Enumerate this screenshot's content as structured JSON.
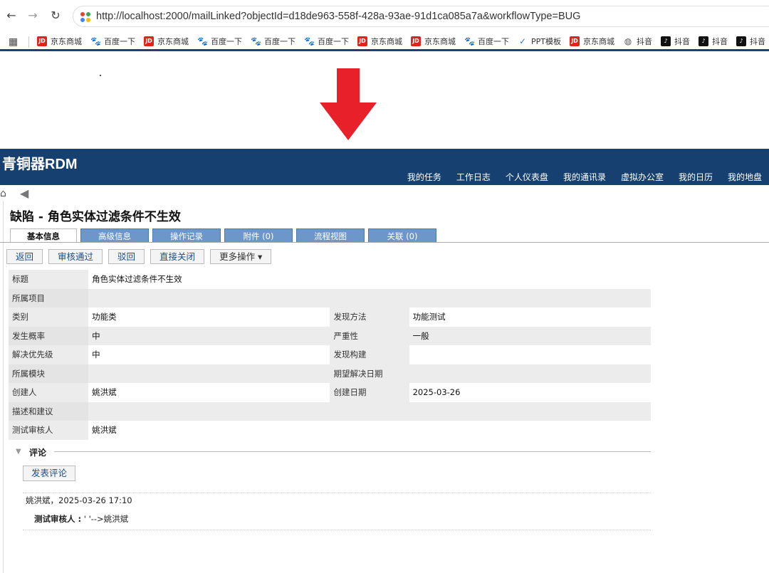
{
  "browser": {
    "url": "http://localhost:2000/mailLinked?objectId=d18de963-558f-428a-93ae-91d1ca085a7a&workflowType=BUG",
    "bookmarks": [
      {
        "icon": "jd-icon",
        "label": "京东商城"
      },
      {
        "icon": "baidu-icon",
        "label": "百度一下"
      },
      {
        "icon": "jd-icon",
        "label": "京东商城"
      },
      {
        "icon": "baidu-icon",
        "label": "百度一下"
      },
      {
        "icon": "baidu-icon",
        "label": "百度一下"
      },
      {
        "icon": "baidu-icon",
        "label": "百度一下"
      },
      {
        "icon": "jd-icon",
        "label": "京东商城"
      },
      {
        "icon": "jd-icon",
        "label": "京东商城"
      },
      {
        "icon": "baidu-icon",
        "label": "百度一下"
      },
      {
        "icon": "ppt-icon",
        "label": "PPT模板"
      },
      {
        "icon": "jd-icon",
        "label": "京东商城"
      },
      {
        "icon": "globe-icon",
        "label": "抖音"
      },
      {
        "icon": "douyin-icon",
        "label": "抖音"
      },
      {
        "icon": "douyin-icon",
        "label": "抖音"
      },
      {
        "icon": "douyin-icon",
        "label": "抖音"
      }
    ]
  },
  "colors": {
    "header_bg": "#15406f",
    "tab_bg": "#6d97c8",
    "arrow": "#e8202a"
  },
  "app": {
    "logo": "青铜器RDM",
    "nav": [
      "我的任务",
      "工作日志",
      "个人仪表盘",
      "我的通讯录",
      "虚拟办公室",
      "我的日历",
      "我的地盘"
    ]
  },
  "page": {
    "title": "缺陷 - 角色实体过滤条件不生效",
    "tabs": [
      "基本信息",
      "高级信息",
      "操作记录",
      "附件 (0)",
      "流程视图",
      "关联 (0)"
    ],
    "actions": {
      "back": "返回",
      "approve": "审核通过",
      "reject": "驳回",
      "close": "直接关闭",
      "more": "更多操作 ▾"
    }
  },
  "fields": {
    "title_label": "标题",
    "title_value": "角色实体过滤条件不生效",
    "project_label": "所属项目",
    "project_value": "",
    "category_label": "类别",
    "category_value": "功能类",
    "method_label": "发现方法",
    "method_value": "功能测试",
    "probability_label": "发生概率",
    "probability_value": "中",
    "severity_label": "严重性",
    "severity_value": "一般",
    "priority_label": "解决优先级",
    "priority_value": "中",
    "build_label": "发现构建",
    "build_value": "",
    "module_label": "所属模块",
    "module_value": "",
    "due_label": "期望解决日期",
    "due_value": "",
    "creator_label": "创建人",
    "creator_value": "姚洪斌",
    "created_label": "创建日期",
    "created_value": "2025-03-26",
    "desc_label": "描述和建议",
    "desc_value": "",
    "reviewer_label": "测试审核人",
    "reviewer_value": "姚洪斌"
  },
  "comments": {
    "section_label": "评论",
    "post_button": "发表评论",
    "items": [
      {
        "meta": "姚洪斌，2025-03-26 17:10",
        "field": "测试审核人 :",
        "change": " ' '-->姚洪斌"
      }
    ]
  }
}
